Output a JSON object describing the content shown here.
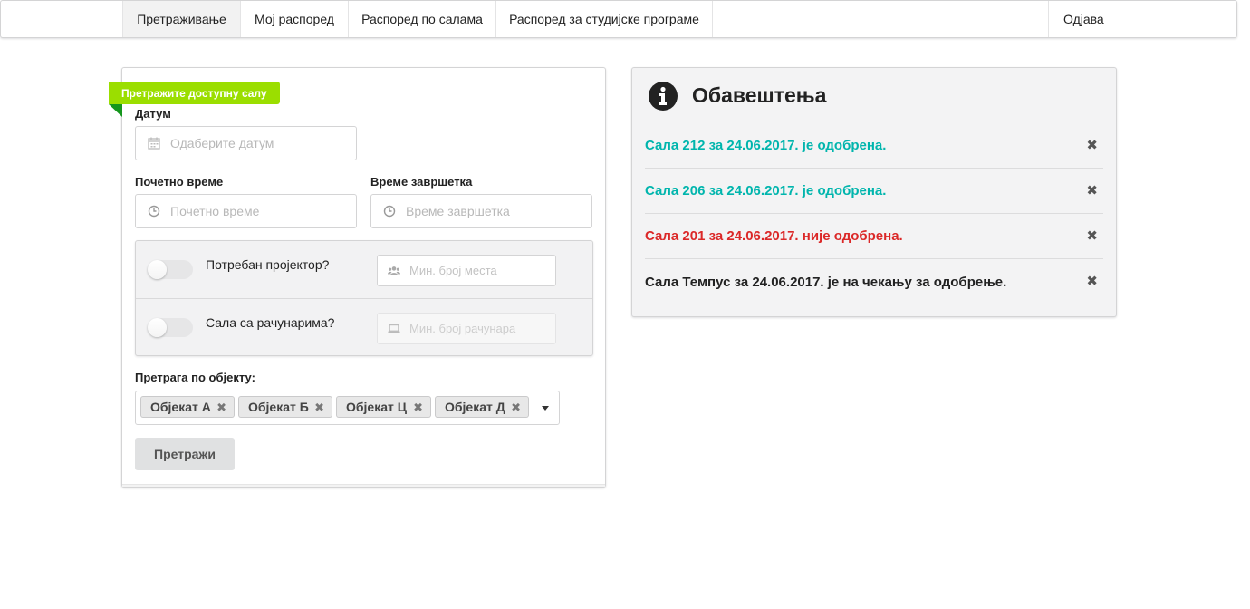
{
  "nav": {
    "items": [
      {
        "label": "Претраживање",
        "active": true
      },
      {
        "label": "Мој распоред",
        "active": false
      },
      {
        "label": "Распоред по салама",
        "active": false
      },
      {
        "label": "Распоред за студијске програме",
        "active": false
      }
    ],
    "logout": "Одјава"
  },
  "search": {
    "ribbon": "Претражите доступну салу",
    "date_label": "Датум",
    "date_placeholder": "Одаберите датум",
    "start_label": "Почетно време",
    "start_placeholder": "Почетно време",
    "end_label": "Време завршетка",
    "end_placeholder": "Време завршетка",
    "projector_label": "Потребан пројектор?",
    "projector_on": false,
    "seats_placeholder": "Мин. број места",
    "computers_label": "Сала са рачунарима?",
    "computers_on": false,
    "computers_placeholder": "Мин. број рачунара",
    "object_label": "Претрага по објекту:",
    "objects": [
      "Објекат А",
      "Објекат Б",
      "Објекат Ц",
      "Објекат Д"
    ],
    "submit": "Претражи"
  },
  "notifications": {
    "title": "Обавештења",
    "items": [
      {
        "text": "Сала 212 за 24.06.2017. је одобрена.",
        "color": "#00b5ad"
      },
      {
        "text": "Сала 206 за 24.06.2017. је одобрена.",
        "color": "#00b5ad"
      },
      {
        "text": "Сала 201 за 24.06.2017. није одобрена.",
        "color": "#db2828"
      },
      {
        "text": "Сала Темпус за 24.06.2017. је на чекању за одобрење.",
        "color": "#222222"
      }
    ],
    "close_glyph": "✖"
  },
  "colors": {
    "ribbon": "#9bde00",
    "ribbon_fold": "#15961d",
    "approved": "#00b5ad",
    "rejected": "#db2828"
  }
}
